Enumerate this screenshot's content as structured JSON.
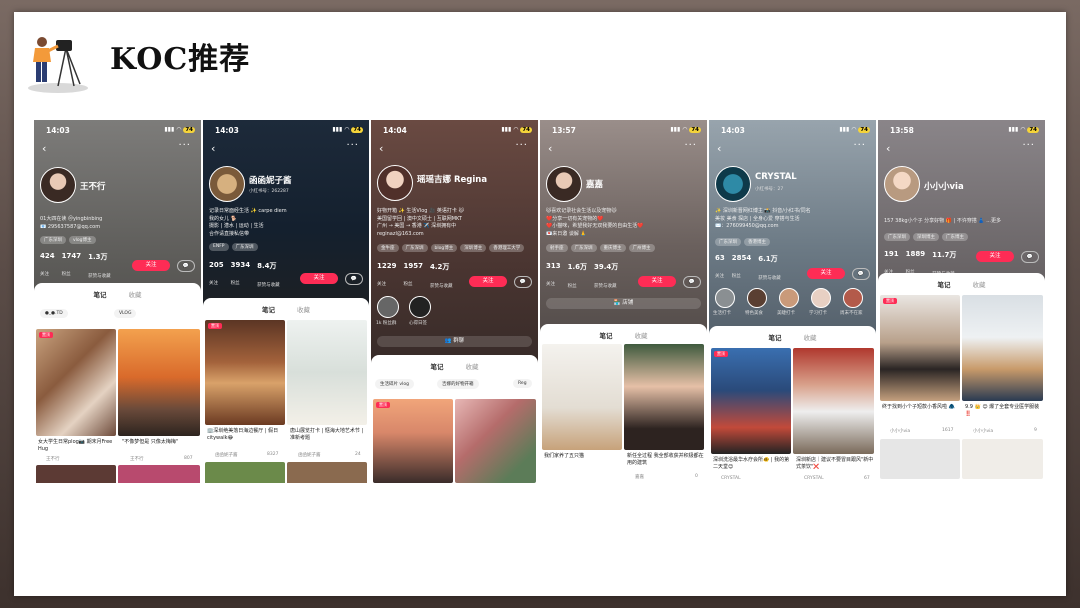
{
  "slide": {
    "title": "KOC推荐",
    "icon": "photographer-icon"
  },
  "colors": {
    "accent": "#fe2c55",
    "battery": "#f5d43a"
  },
  "phones": [
    {
      "time": "14:03",
      "battery": "74",
      "name": "王不行",
      "bio": "01大四在读 ＠yingbinbing\n📧 295637587@qq.com",
      "tags": [
        "广东深圳",
        "vlog博主"
      ],
      "stats": [
        {
          "n": "424",
          "l": "关注"
        },
        {
          "n": "1747",
          "l": "粉丝"
        },
        {
          "n": "1.3万",
          "l": "获赞与收藏"
        }
      ],
      "follow": "关注",
      "tab_notes": "笔记",
      "tab_collect": "收藏",
      "pills": [
        "●_●.TD",
        "VLOG"
      ],
      "posts": [
        {
          "caption": "女大学生日常plog📷 期末月Free Hug",
          "author": "王不行",
          "likes": ""
        },
        {
          "caption": "\"不像梦但是 只像太梅梅\"",
          "author": "王不行",
          "likes": "807"
        }
      ]
    },
    {
      "time": "14:03",
      "battery": "74",
      "name": "函函妮子酱",
      "sub": "小红书号：262287",
      "bio": "记录日常面经生活 ✨ carpe diem\n我的女儿 🐕\n摄影 | 潜水 | 运动 | 生活\n合作请直接私信带",
      "tags": [
        "ENFP",
        "广东深圳"
      ],
      "stats": [
        {
          "n": "205",
          "l": "关注"
        },
        {
          "n": "3934",
          "l": "粉丝"
        },
        {
          "n": "8.4万",
          "l": "获赞与收藏"
        }
      ],
      "follow": "关注",
      "tab_notes": "笔记",
      "tab_collect": "收藏",
      "posts": [
        {
          "caption": "🏢深圳绝美落日海边餐厅 | 假日citywalk😂",
          "author": "函函妮子酱",
          "likes": "8327"
        },
        {
          "caption": "唐山展览打卡 | 惬海大地艺术节 | 准新考题",
          "author": "函函妮子酱",
          "likes": "24"
        }
      ]
    },
    {
      "time": "14:04",
      "battery": "74",
      "name": "瑶瑶吉娜 Regina",
      "bio": "好物开箱 ✨ 生活Vlog 🎥 英语打卡 🐱\n美国留学回 | 澳中文硕士 | 互联网MKT\n广州 → 美国 → 香港 ✈️ 深圳拥有中\nreginazl@163.com",
      "tags": [
        "金牛座",
        "广东深圳",
        "blog博主",
        "深圳博主",
        "香港理工大学"
      ],
      "stats": [
        {
          "n": "1229",
          "l": "关注"
        },
        {
          "n": "1957",
          "l": "粉丝"
        },
        {
          "n": "4.2万",
          "l": "获赞与收藏"
        }
      ],
      "follow": "关注",
      "groups": [
        "1k 粉丝群",
        "心得日签"
      ],
      "group_btn": "群聊",
      "tab_notes": "笔记",
      "tab_collect": "收藏",
      "pills": [
        "生活碎片 vlog",
        "吉娜的好物开箱",
        "Reg"
      ]
    },
    {
      "time": "13:57",
      "battery": "74",
      "name": "嘉嘉",
      "bio": "🐱喜欢记录社会生活以及宠物🐱\n❤️分享一切有关宠物的❤️\n❤️小猫咪，希望我好无双我要的自由生活❤️\n💌来日邀 谈解 🙏",
      "tags": [
        "射手座",
        "广东深圳",
        "重庆博主",
        "广州博主"
      ],
      "stats": [
        {
          "n": "313",
          "l": "关注"
        },
        {
          "n": "1.6万",
          "l": "粉丝"
        },
        {
          "n": "39.4万",
          "l": "获赞与收藏"
        }
      ],
      "follow": "关注",
      "shop": "店铺",
      "tab_notes": "笔记",
      "tab_collect": "收藏",
      "posts": [
        {
          "caption": "我们家养了五只猫",
          "author": "嘉嘉",
          "likes": ""
        },
        {
          "caption": "新任全过程 我全部收获并积极都在用的建筑",
          "author": "嘉嘉",
          "likes": "0"
        }
      ]
    },
    {
      "time": "14:03",
      "battery": "74",
      "name": "CRYSTAL",
      "sub": "小红书号：27",
      "bio": "✨ 深圳新晋网红博主 📸 抖音/小红书/同名\n美妆 美食 探店 | 全身心爱 穿搭与生活\n✉️：276099450@qq.com",
      "tags": [
        "广东深圳",
        "香港博主"
      ],
      "stats": [
        {
          "n": "63",
          "l": "关注"
        },
        {
          "n": "2854",
          "l": "粉丝"
        },
        {
          "n": "6.1万",
          "l": "获赞与收藏"
        }
      ],
      "follow": "关注",
      "highlights": [
        "生活打卡",
        "特色美食",
        "美睫打卡",
        "学习打卡",
        "周末不在家"
      ],
      "tab_notes": "笔记",
      "tab_collect": "收藏",
      "posts": [
        {
          "caption": "深圳洗浴最华水疗会所🐠 | 我的第二天堂😊",
          "author": "CRYSTAL",
          "likes": ""
        },
        {
          "caption": "深圳新店｜建议不要冒目跟风\"新中式茶饮\"❌",
          "author": "CRYSTAL",
          "likes": "67"
        }
      ]
    },
    {
      "time": "13:58",
      "battery": "74",
      "name": "小小小via",
      "bio": "157 38kg小个子 分享好物 🎁 | 不许穿搭 👗 ...更多",
      "tags": [
        "广东深圳",
        "深圳博主",
        "广东博主"
      ],
      "stats": [
        {
          "n": "191",
          "l": "关注"
        },
        {
          "n": "1889",
          "l": "粉丝"
        },
        {
          "n": "11.7万",
          "l": "获赞与收藏"
        }
      ],
      "follow": "关注",
      "tab_notes": "笔记",
      "tab_collect": "收藏",
      "posts": [
        {
          "caption": "终于找到小个子短款小香风啦 🧥",
          "author": "小小小via",
          "likes": "1617"
        },
        {
          "caption": "9.9 👑 😊 爆了全套专业医学服装 ‼️",
          "author": "小小小via",
          "likes": "9"
        }
      ]
    }
  ]
}
